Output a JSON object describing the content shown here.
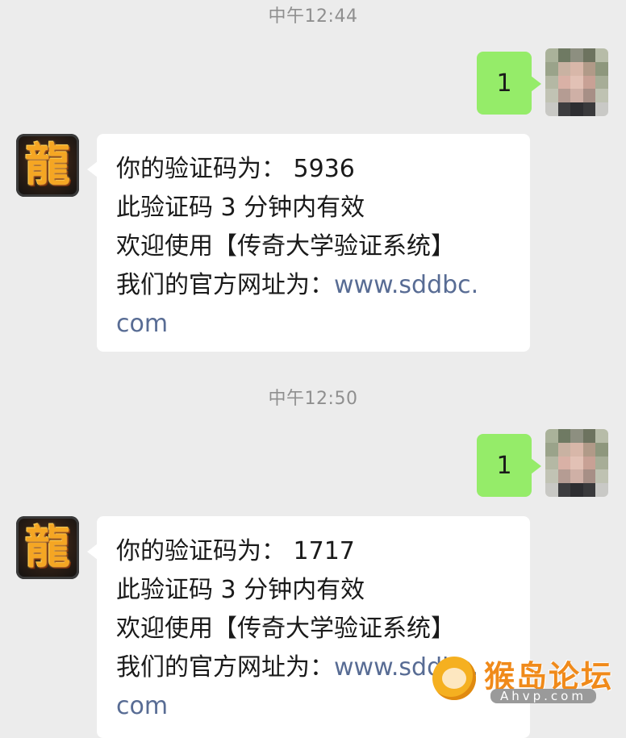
{
  "messages": [
    {
      "time": "中午12:44",
      "sent": "1",
      "reply": {
        "line1": "你的验证码为：  5936",
        "line2": "此验证码 3 分钟内有效",
        "line3": "欢迎使用【传奇大学验证系统】",
        "line4_prefix": "我们的官方网址为：",
        "link_part1": "www.sddbc.",
        "link_part2": "com"
      }
    },
    {
      "time": "中午12:50",
      "sent": "1",
      "reply": {
        "line1": "你的验证码为：  1717",
        "line2": "此验证码 3 分钟内有效",
        "line3": "欢迎使用【传奇大学验证系统】",
        "line4_prefix": "我们的官方网址为：",
        "link_part1": "www.sddbc.",
        "link_part2": "com"
      }
    }
  ],
  "bot_avatar_glyph": "龍",
  "watermark": {
    "title": "猴岛论坛",
    "subtitle": "Ahvp.com"
  },
  "colors": {
    "background": "#ececec",
    "sent_bubble": "#95ec69",
    "received_bubble": "#ffffff",
    "link": "#586c94",
    "timestamp": "#8f8f8f"
  }
}
